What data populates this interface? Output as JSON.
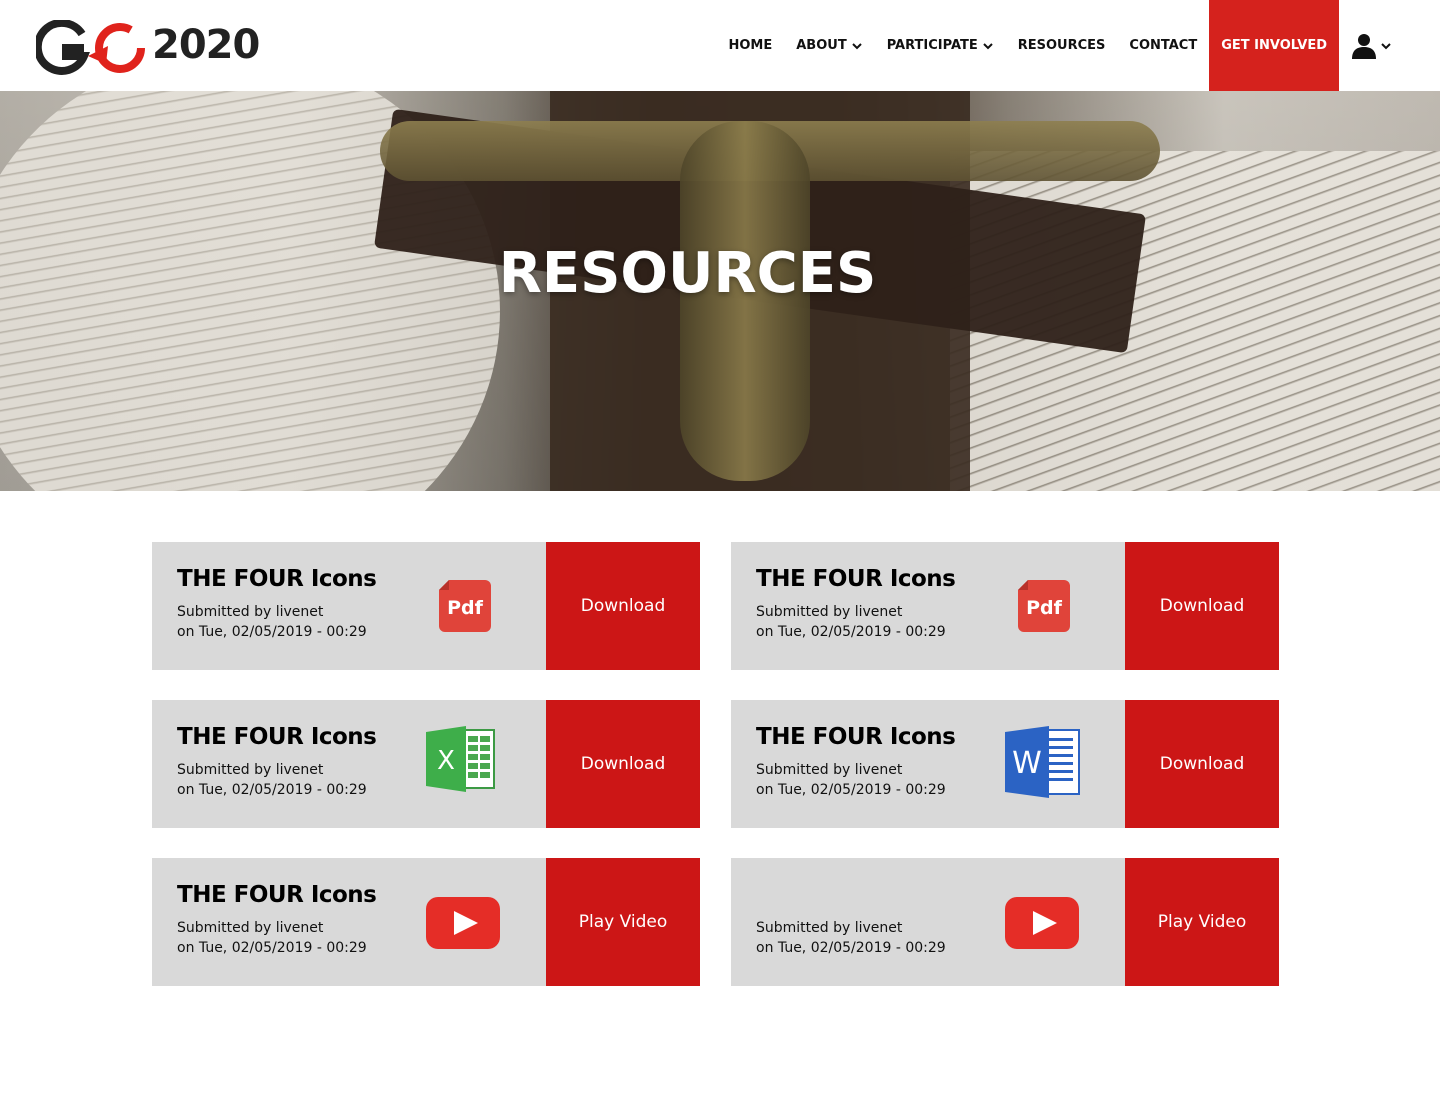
{
  "brand": {
    "logo_text": "2020",
    "logo_letters": "G",
    "accent": "#d5221d"
  },
  "nav": {
    "home": "HOME",
    "about": "ABOUT",
    "participate": "PARTICIPATE",
    "resources": "RESOURCES",
    "contact": "CONTACT",
    "get_involved": "GET INVOLVED",
    "user_icon": "user-icon"
  },
  "hero": {
    "title": "RESOURCES"
  },
  "cards": [
    {
      "title": "THE FOUR Icons",
      "submitted": "Submitted by livenet",
      "date": "on Tue, 02/05/2019 - 00:29",
      "icon": "pdf-icon",
      "button": "Download"
    },
    {
      "title": "THE FOUR Icons",
      "submitted": "Submitted by livenet",
      "date": "on Tue, 02/05/2019 - 00:29",
      "icon": "pdf-icon",
      "button": "Download"
    },
    {
      "title": "THE FOUR Icons",
      "submitted": "Submitted by livenet",
      "date": "on Tue, 02/05/2019 - 00:29",
      "icon": "excel-icon",
      "button": "Download"
    },
    {
      "title": "THE FOUR Icons",
      "submitted": "Submitted by livenet",
      "date": "on Tue, 02/05/2019 - 00:29",
      "icon": "word-icon",
      "button": "Download"
    },
    {
      "title": "THE FOUR Icons",
      "submitted": "Submitted by livenet",
      "date": "on Tue, 02/05/2019 - 00:29",
      "icon": "youtube-icon",
      "button": "Play Video"
    },
    {
      "title": "",
      "submitted": "Submitted by livenet",
      "date": "on Tue, 02/05/2019 - 00:29",
      "icon": "youtube-icon",
      "button": "Play Video"
    }
  ],
  "icon_labels": {
    "pdf": "Pdf",
    "excel": "X",
    "word": "W"
  }
}
